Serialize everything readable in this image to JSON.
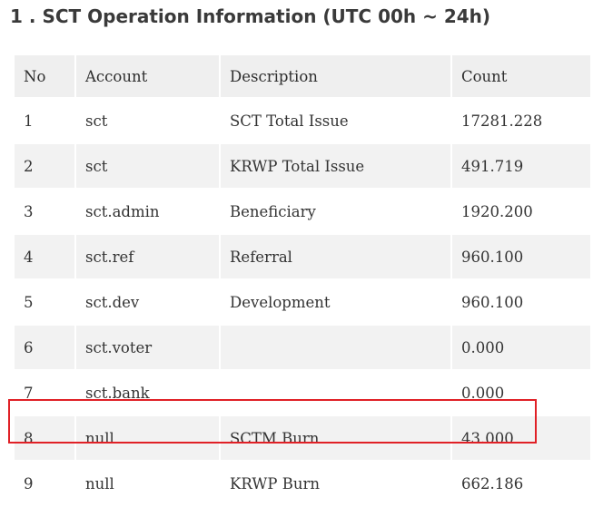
{
  "section": {
    "title": "1 . SCT Operation Information (UTC 00h ~ 24h)"
  },
  "table": {
    "headers": [
      "No",
      "Account",
      "Description",
      "Count"
    ],
    "rows": [
      {
        "no": "1",
        "account": "sct",
        "description": "SCT Total Issue",
        "count": "17281.228"
      },
      {
        "no": "2",
        "account": "sct",
        "description": "KRWP Total Issue",
        "count": "491.719"
      },
      {
        "no": "3",
        "account": "sct.admin",
        "description": "Beneficiary",
        "count": "1920.200"
      },
      {
        "no": "4",
        "account": "sct.ref",
        "description": "Referral",
        "count": "960.100"
      },
      {
        "no": "5",
        "account": "sct.dev",
        "description": "Development",
        "count": "960.100"
      },
      {
        "no": "6",
        "account": "sct.voter",
        "description": "",
        "count": "0.000"
      },
      {
        "no": "7",
        "account": "sct.bank",
        "description": "",
        "count": "0.000"
      },
      {
        "no": "8",
        "account": "null",
        "description": "SCTM Burn",
        "count": "43.000"
      },
      {
        "no": "9",
        "account": "null",
        "description": "KRWP Burn",
        "count": "662.186"
      }
    ]
  },
  "highlight": {
    "row_no": "8",
    "color": "#e02026"
  }
}
